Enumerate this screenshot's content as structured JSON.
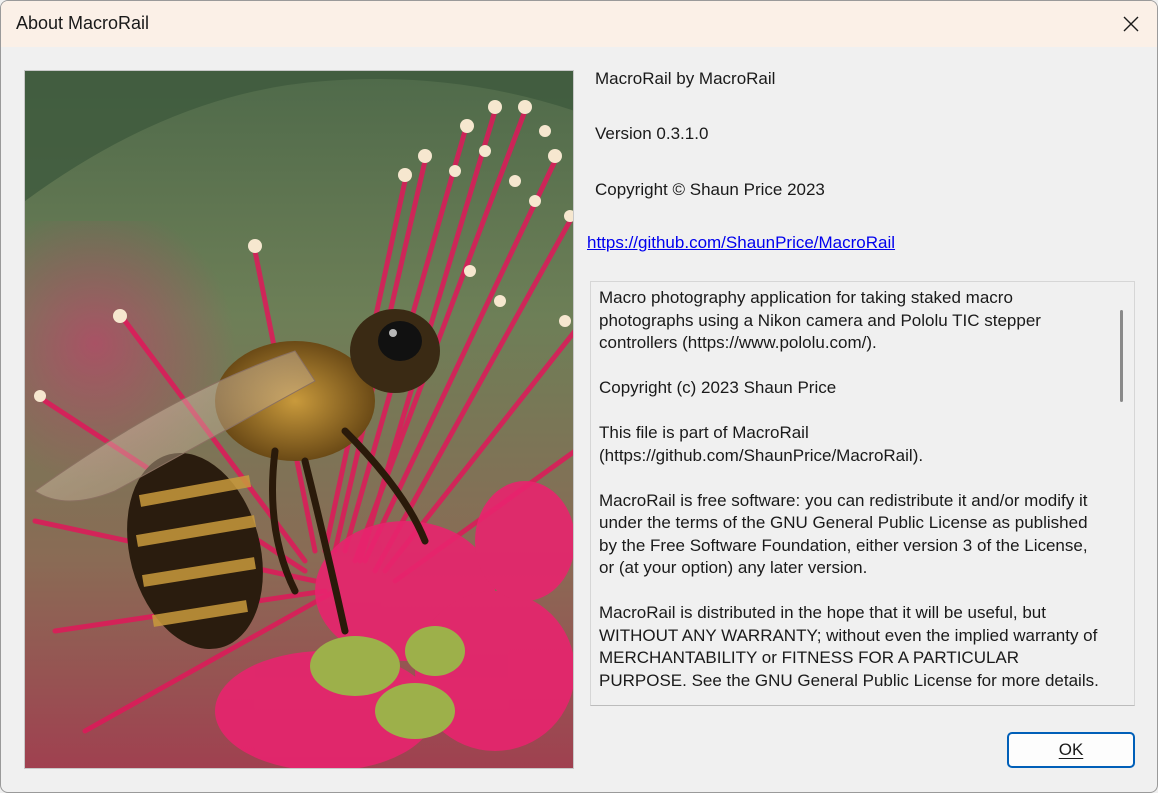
{
  "window": {
    "title": "About MacroRail"
  },
  "info": {
    "product": "MacroRail by MacroRail",
    "version": "Version 0.3.1.0",
    "copyright": "Copyright © Shaun Price 2023",
    "url": "https://github.com/ShaunPrice/MacroRail"
  },
  "description": {
    "text": "Macro photography application for taking staked macro photographs using a Nikon camera and Pololu TIC stepper controllers (https://www.pololu.com/).\n\nCopyright (c) 2023 Shaun Price\n\nThis file is part of MacroRail (https://github.com/ShaunPrice/MacroRail).\n\nMacroRail is free software: you can redistribute it and/or modify it under the terms of the GNU General Public License as published by the Free Software Foundation, either version 3 of the License, or (at your option) any later version.\n\nMacroRail is distributed in the hope that it will be useful, but WITHOUT ANY WARRANTY; without even the implied warranty of MERCHANTABILITY or FITNESS FOR A PARTICULAR PURPOSE. See the GNU General Public License for more details."
  },
  "buttons": {
    "ok_label": "OK"
  },
  "icons": {
    "close": "close-icon"
  },
  "colors": {
    "accent": "#005fb8",
    "link": "#0000ee",
    "titlebar": "#fbf0e7"
  }
}
